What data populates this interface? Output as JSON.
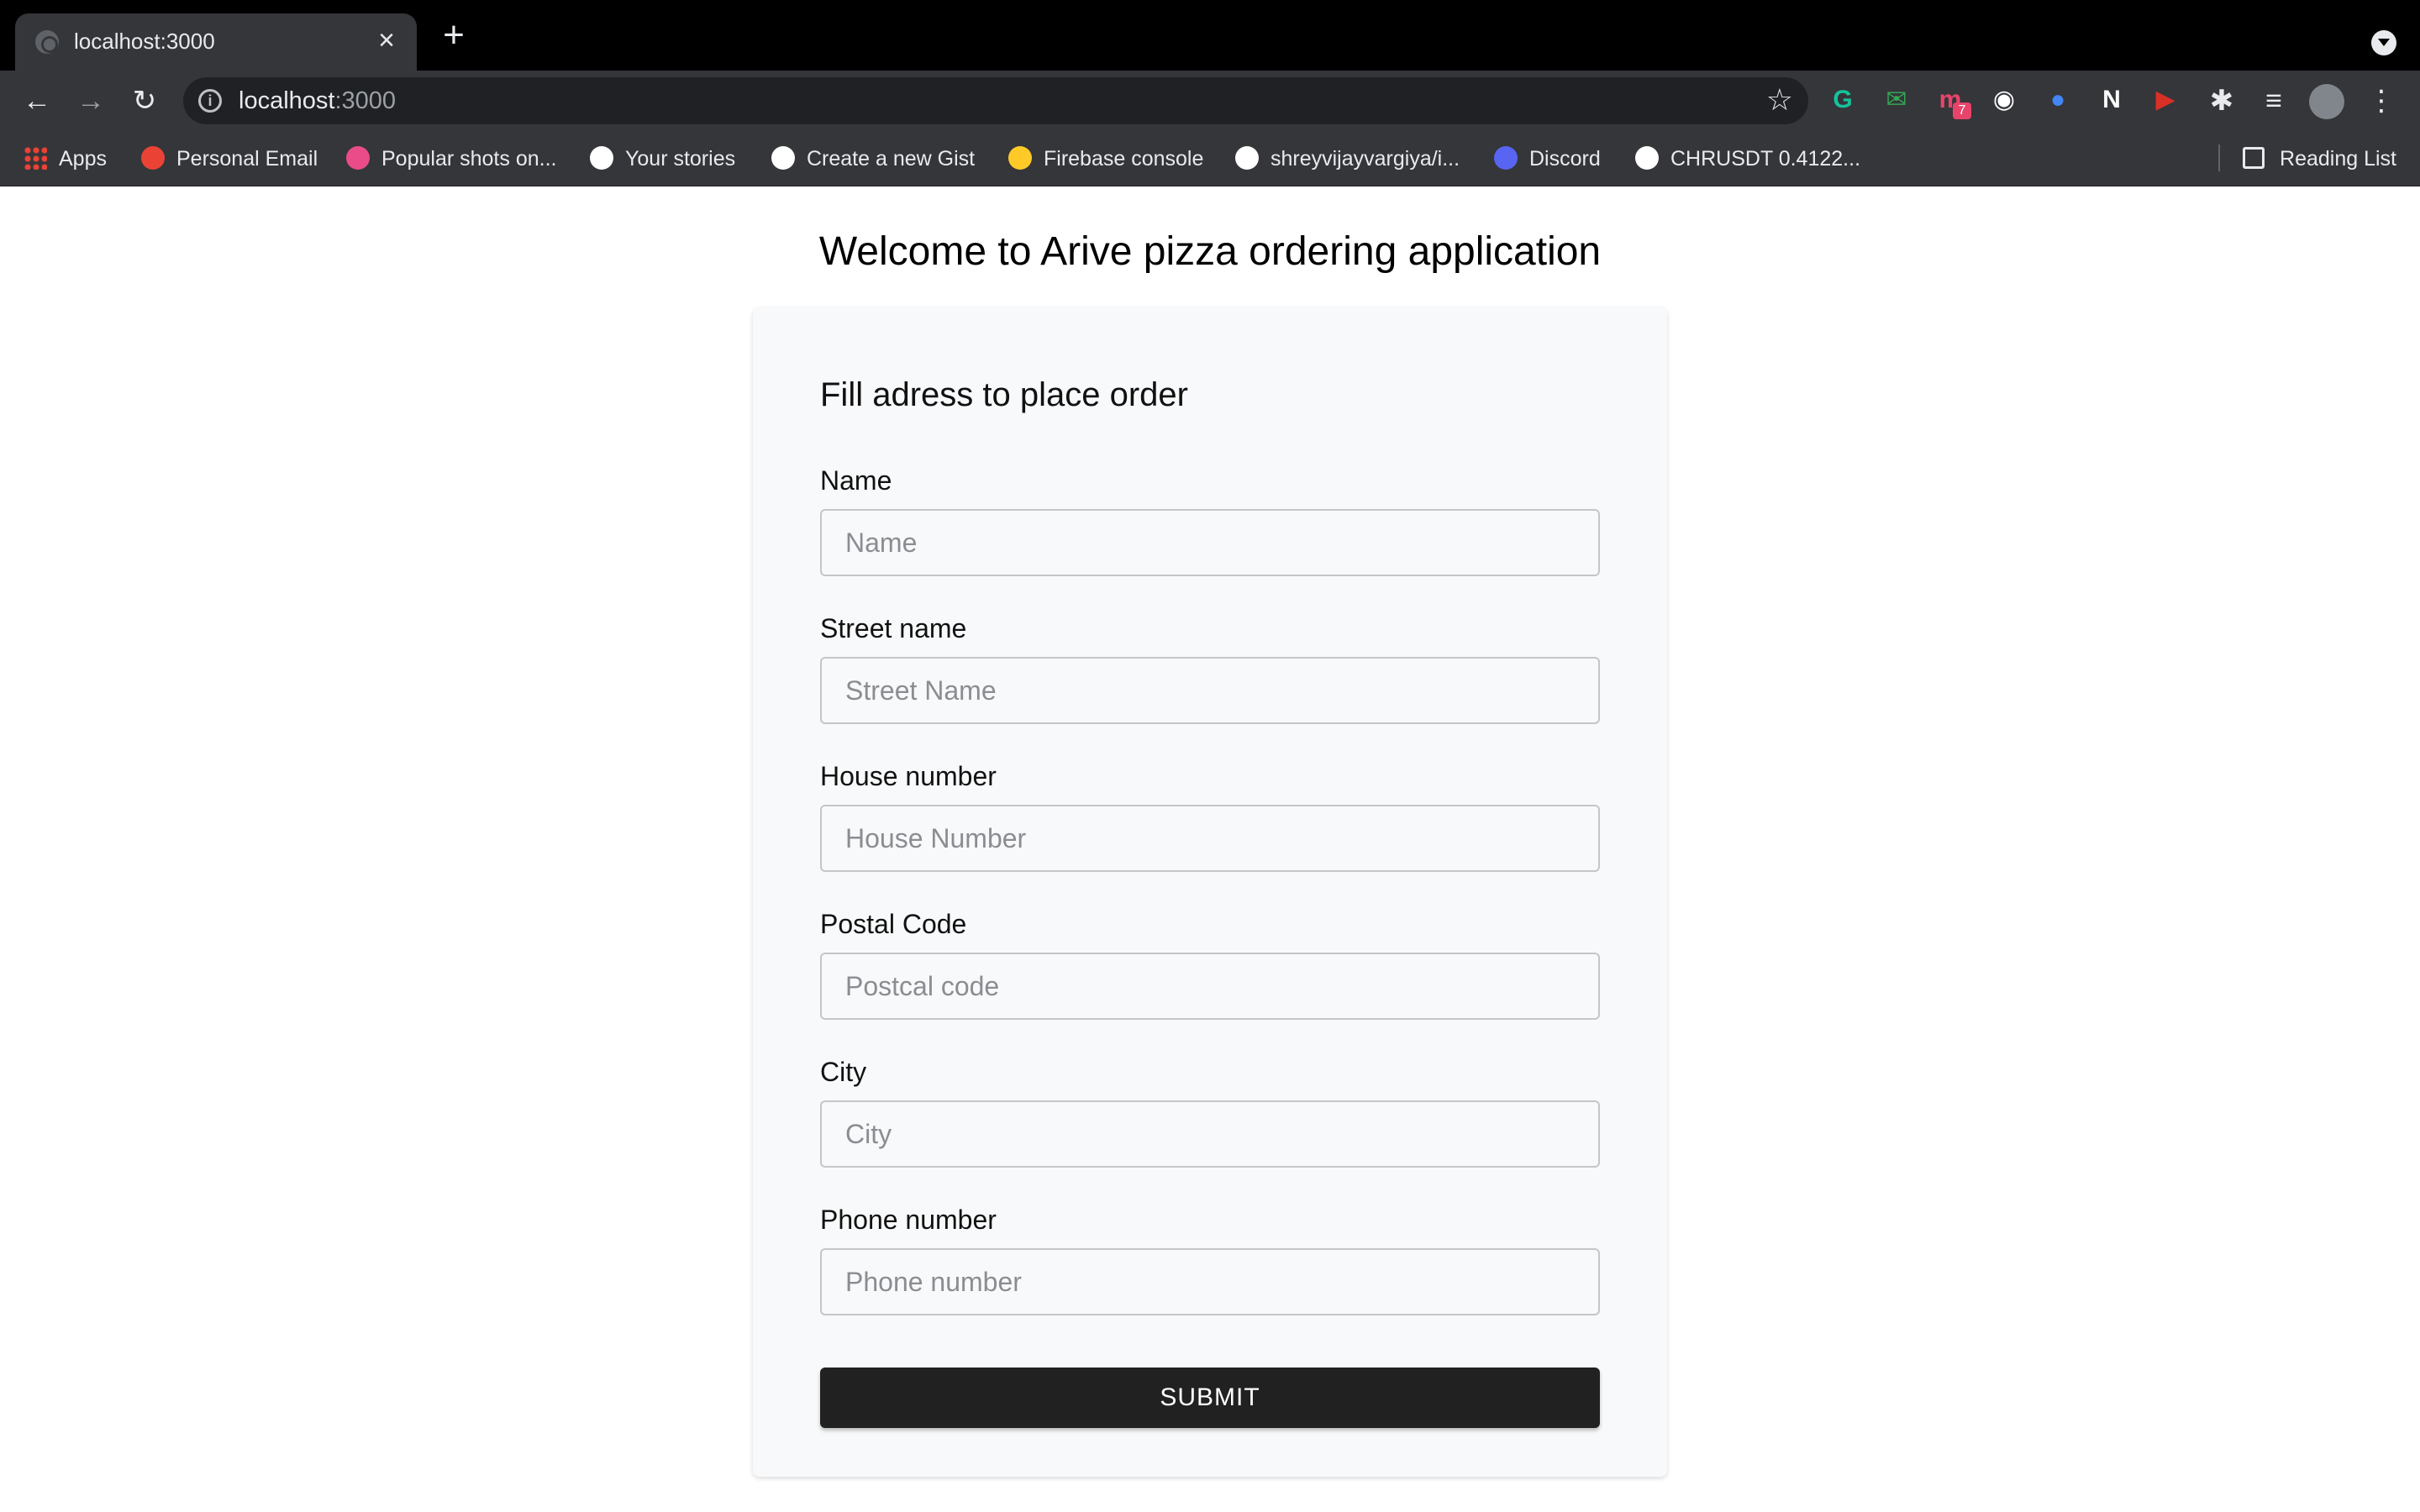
{
  "browser": {
    "tab_title": "localhost:3000",
    "tab_close": "×",
    "new_tab": "+",
    "url_host": "localhost",
    "url_port": ":3000",
    "bookmarks": [
      {
        "label": "Apps",
        "icon": "apps-grid-icon",
        "color": "#ea4335"
      },
      {
        "label": "Personal Email",
        "icon": "gmail-icon",
        "color": "#ea4335"
      },
      {
        "label": "Popular shots on...",
        "icon": "dribbble-icon",
        "color": "#ea4c89"
      },
      {
        "label": "Your stories",
        "icon": "medium-icon",
        "color": "#ffffff"
      },
      {
        "label": "Create a new Gist",
        "icon": "github-icon",
        "color": "#ffffff"
      },
      {
        "label": "Firebase console",
        "icon": "firebase-icon",
        "color": "#ffca28"
      },
      {
        "label": "shreyvijayvargiya/i...",
        "icon": "github-icon",
        "color": "#ffffff"
      },
      {
        "label": "Discord",
        "icon": "discord-icon",
        "color": "#5865f2"
      },
      {
        "label": "CHRUSDT 0.4122...",
        "icon": "tradingview-icon",
        "color": "#ffffff"
      }
    ],
    "reading_list": "Reading List",
    "extensions": [
      {
        "name": "grammarly-icon",
        "color": "#15c39a",
        "glyph": "G"
      },
      {
        "name": "mail-extension-icon",
        "color": "#34a853",
        "glyph": "✉"
      },
      {
        "name": "extension-badge-icon",
        "color": "#e8446b",
        "glyph": "m",
        "badge": "7"
      },
      {
        "name": "extension-circle-icon",
        "color": "#ffffff",
        "glyph": "◉"
      },
      {
        "name": "globe-extension-icon",
        "color": "#4285f4",
        "glyph": "●"
      },
      {
        "name": "notion-icon",
        "color": "#ffffff",
        "glyph": "N"
      },
      {
        "name": "video-extension-icon",
        "color": "#d93025",
        "glyph": "▶"
      }
    ]
  },
  "page": {
    "heading": "Welcome to Arive pizza ordering application",
    "form": {
      "title": "Fill adress to place order",
      "fields": [
        {
          "label": "Name",
          "placeholder": "Name"
        },
        {
          "label": "Street name",
          "placeholder": "Street Name"
        },
        {
          "label": "House number",
          "placeholder": "House Number"
        },
        {
          "label": "Postal Code",
          "placeholder": "Postcal code"
        },
        {
          "label": "City",
          "placeholder": "City"
        },
        {
          "label": "Phone number",
          "placeholder": "Phone number"
        }
      ],
      "submit_label": "SUBMIT"
    }
  }
}
